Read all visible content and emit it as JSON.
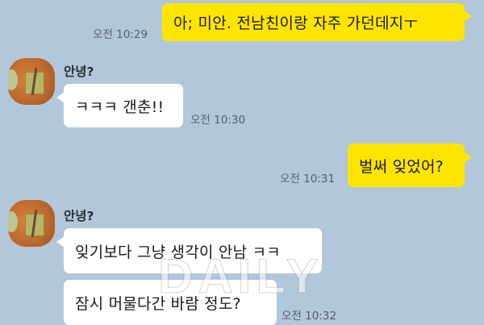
{
  "chat": {
    "contact_name": "안녕?",
    "messages": [
      {
        "from": "me",
        "text": "아; 미안. 전남친이랑 자주 가던데지ㅜ",
        "time": "오전 10:29"
      },
      {
        "from": "them",
        "text": "ㅋㅋㅋ 갠춘!!",
        "time": "오전 10:30"
      },
      {
        "from": "me",
        "text": "벌써 잊었어?",
        "time": "오전 10:31"
      },
      {
        "from": "them",
        "text": "잊기보다 그냥 생각이 안남 ㅋㅋ",
        "time": ""
      },
      {
        "from": "them",
        "text": "잠시 머물다간 바람 정도?",
        "time": "오전 10:32"
      }
    ]
  },
  "watermark": "DAILY",
  "colors": {
    "background": "#b2c7d9",
    "my_bubble": "#fee500",
    "their_bubble": "#ffffff"
  },
  "icons": {
    "avatar": "profile-avatar-icon"
  }
}
